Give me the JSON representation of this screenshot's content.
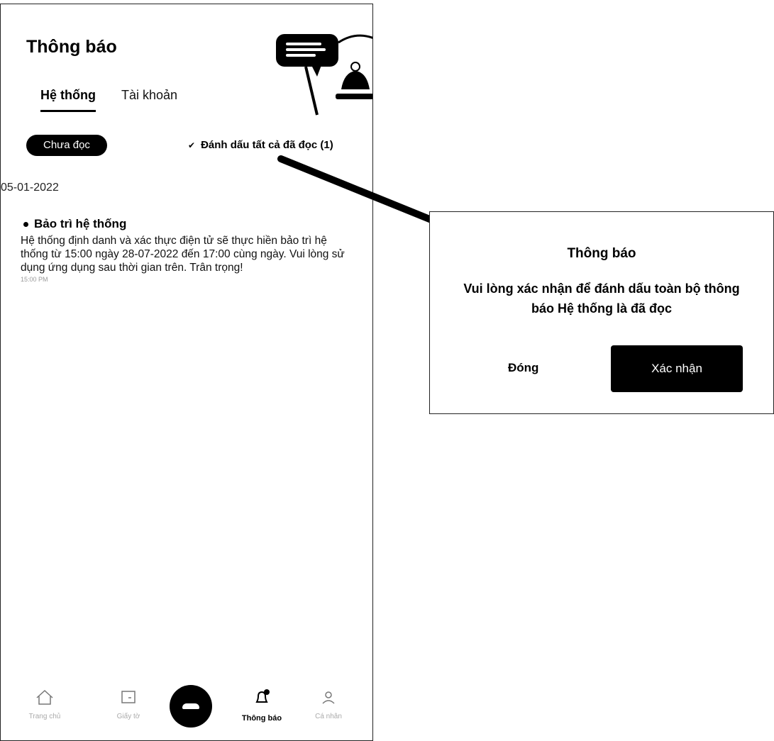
{
  "header": {
    "title": "Thông báo"
  },
  "tabs": [
    {
      "label": "Hệ thống",
      "active": true
    },
    {
      "label": "Tài khoản",
      "active": false
    }
  ],
  "filter": {
    "label": "Chưa đọc"
  },
  "mark_all": {
    "label": "Đánh dấu tất cả đã đọc (1)",
    "icon": "check-icon"
  },
  "list": {
    "date": "05-01-2022",
    "items": [
      {
        "title": "Bảo trì hệ thống",
        "body": "Hệ thống định danh và xác thực điện tử sẽ thực hiền bảo trì hệ thống từ 15:00 ngày 28-07-2022 đến 17:00 cùng ngày. Vui lòng sử dụng ứng dụng sau thời gian trên. Trân trọng!",
        "time": "15:00 PM"
      }
    ]
  },
  "bottom_nav": [
    {
      "label": "Trang chủ",
      "icon": "home-icon"
    },
    {
      "label": "Giấy tờ",
      "icon": "wallet-icon"
    },
    {
      "label": "",
      "icon": "scan-icon"
    },
    {
      "label": "Thông báo",
      "icon": "bell-icon",
      "active": true
    },
    {
      "label": "Cá nhân",
      "icon": "user-icon"
    }
  ],
  "dialog": {
    "title": "Thông báo",
    "message": "Vui lòng xác nhận để đánh dấu toàn bộ thông báo Hệ thống là đã đọc",
    "close_label": "Đóng",
    "confirm_label": "Xác nhận"
  },
  "colors": {
    "primary": "#000000",
    "background": "#ffffff",
    "muted": "#aaaaaa"
  }
}
